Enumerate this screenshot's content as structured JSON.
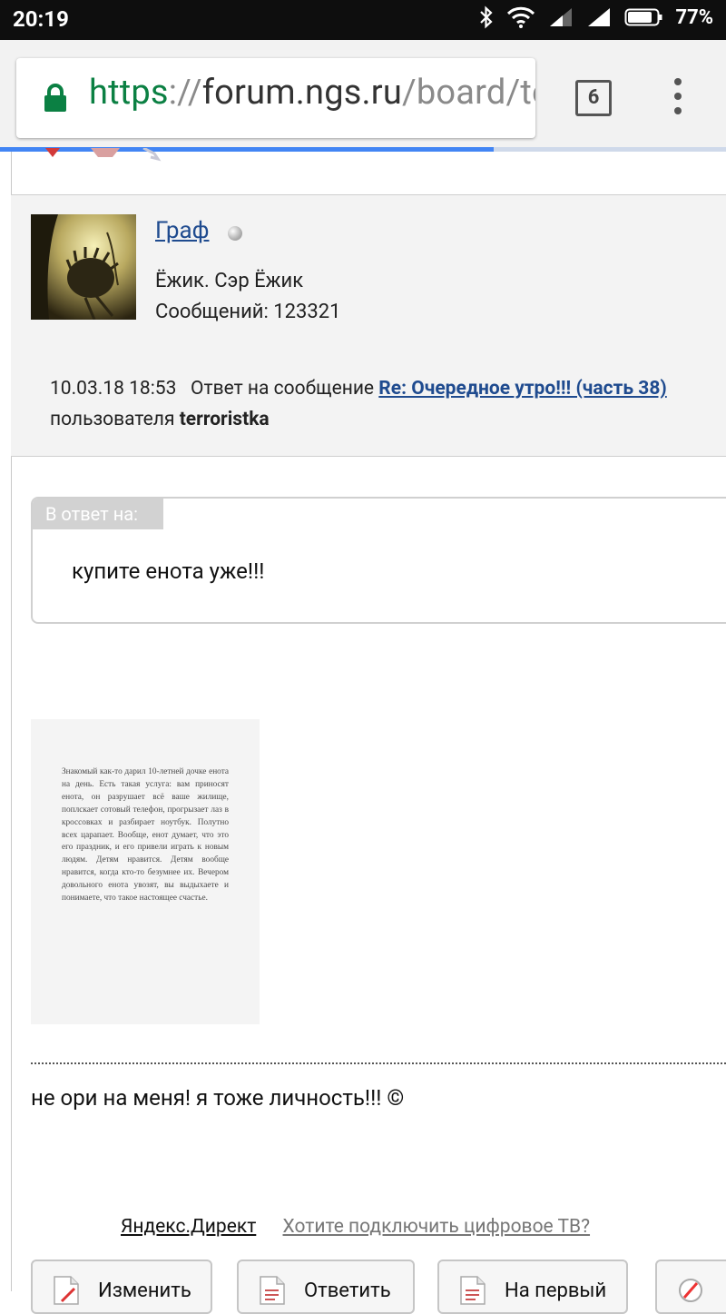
{
  "status_bar": {
    "time": "20:19",
    "battery": "77%"
  },
  "browser": {
    "url_scheme": "https",
    "url_sep": "://",
    "url_host": "forum.ngs.ru",
    "url_path": "/board/te",
    "tab_count": "6",
    "load_progress": 0.68
  },
  "profile": {
    "username": "Граф",
    "title": "Ёжик. Сэр Ёжик",
    "posts": "Сообщений: 123321"
  },
  "post_meta": {
    "datetime": "10.03.18 18:53",
    "reply_to_prefix": "Ответ на сообщение",
    "reply_to_link": "Re: Очередное утро!!! (часть 38)",
    "user_prefix": "пользователя",
    "user": "terroristka"
  },
  "quote": {
    "tag": "В ответ на:",
    "text": "купите енота уже!!!"
  },
  "image_text": "Знакомый как-то дарил 10-летней дочке енота на день. Есть такая услуга: вам приносят енота, он разрушает всё ваше жилище, поплскает сотовый телефон, прогрызает лаз в кроссовках и разбирает ноутбук. Полутно всех царапает. Вообще, енот думает, что это его праздник, и его привели играть к новым людям. Детям нравится. Детям вообще нравится, когда кто-то безумнее их. Вечером довольного енота увозят, вы выдыхаете и понимаете, что такое настоящее счастье.",
  "signature": "не ори на меня! я тоже личность!!! ©",
  "ads": {
    "label": "Яндекс.Директ",
    "link": "Хотите подключить цифровое ТВ?"
  },
  "buttons": [
    {
      "label": "Изменить"
    },
    {
      "label": "Ответить"
    },
    {
      "label": "На первый"
    }
  ]
}
